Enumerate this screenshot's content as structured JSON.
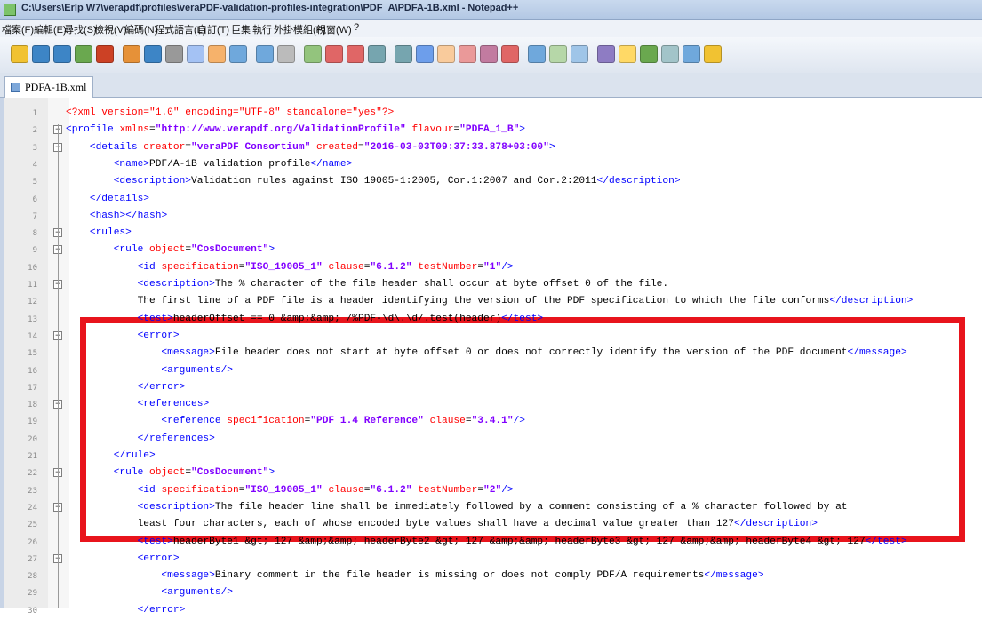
{
  "window": {
    "title": "C:\\Users\\Erlp W7\\verapdf\\profiles\\veraPDF-validation-profiles-integration\\PDF_A\\PDFA-1B.xml - Notepad++"
  },
  "menu": [
    "檔案(F)",
    "編輯(E)",
    "尋找(S)",
    "檢視(V)",
    "編碼(N)",
    "程式語言(L)",
    "自訂(T)",
    "巨集",
    "執行",
    "外掛模組(P)",
    "視窗(W)",
    "?"
  ],
  "tab": {
    "label": "PDFA-1B.xml"
  },
  "colors": {
    "highlight": "#e8141c",
    "tag": "#0000ff",
    "attribute": "#ff0000",
    "value": "#8000ff"
  },
  "lines": [
    {
      "n": "1",
      "text": "<?xml version=\"1.0\" encoding=\"UTF-8\" standalone=\"yes\"?>"
    },
    {
      "n": "2",
      "text": "<profile xmlns=\"http://www.verapdf.org/ValidationProfile\" flavour=\"PDFA_1_B\">"
    },
    {
      "n": "3",
      "text": "    <details creator=\"veraPDF Consortium\" created=\"2016-03-03T09:37:33.878+03:00\">"
    },
    {
      "n": "4",
      "text": "        <name>PDF/A-1B validation profile</name>"
    },
    {
      "n": "5",
      "text": "        <description>Validation rules against ISO 19005-1:2005, Cor.1:2007 and Cor.2:2011</description>"
    },
    {
      "n": "6",
      "text": "    </details>"
    },
    {
      "n": "7",
      "text": "    <hash></hash>"
    },
    {
      "n": "8",
      "text": "    <rules>"
    },
    {
      "n": "9",
      "text": "        <rule object=\"CosDocument\">"
    },
    {
      "n": "10",
      "text": "            <id specification=\"ISO_19005_1\" clause=\"6.1.2\" testNumber=\"1\"/>"
    },
    {
      "n": "11",
      "text": "            <description>The % character of the file header shall occur at byte offset 0 of the file."
    },
    {
      "n": "12",
      "text": "            The first line of a PDF file is a header identifying the version of the PDF specification to which the file conforms</description>"
    },
    {
      "n": "13",
      "text": "            <test>headerOffset == 0 &amp;&amp; /%PDF-\\d\\.\\d/.test(header)</test>"
    },
    {
      "n": "14",
      "text": "            <error>"
    },
    {
      "n": "15",
      "text": "                <message>File header does not start at byte offset 0 or does not correctly identify the version of the PDF document</message>"
    },
    {
      "n": "16",
      "text": "                <arguments/>"
    },
    {
      "n": "17",
      "text": "            </error>"
    },
    {
      "n": "18",
      "text": "            <references>"
    },
    {
      "n": "19",
      "text": "                <reference specification=\"PDF 1.4 Reference\" clause=\"3.4.1\"/>"
    },
    {
      "n": "20",
      "text": "            </references>"
    },
    {
      "n": "21",
      "text": "        </rule>"
    },
    {
      "n": "22",
      "text": "        <rule object=\"CosDocument\">"
    },
    {
      "n": "23",
      "text": "            <id specification=\"ISO_19005_1\" clause=\"6.1.2\" testNumber=\"2\"/>"
    },
    {
      "n": "24",
      "text": "            <description>The file header line shall be immediately followed by a comment consisting of a % character followed by at"
    },
    {
      "n": "25",
      "text": "            least four characters, each of whose encoded byte values shall have a decimal value greater than 127</description>"
    },
    {
      "n": "26",
      "text": "            <test>headerByte1 &gt; 127 &amp;&amp; headerByte2 &gt; 127 &amp;&amp; headerByte3 &gt; 127 &amp;&amp; headerByte4 &gt; 127</test>"
    },
    {
      "n": "27",
      "text": "            <error>"
    },
    {
      "n": "28",
      "text": "                <message>Binary comment in the file header is missing or does not comply PDF/A requirements</message>"
    },
    {
      "n": "29",
      "text": "                <arguments/>"
    },
    {
      "n": "30",
      "text": "            </error>"
    }
  ]
}
